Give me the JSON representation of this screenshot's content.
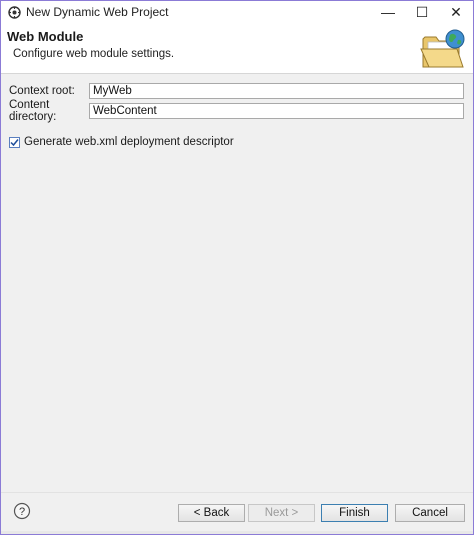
{
  "window": {
    "title": "New Dynamic Web Project",
    "minimize_glyph": "—",
    "maximize_glyph": "☐",
    "close_glyph": "✕"
  },
  "banner": {
    "title": "Web Module",
    "description": "Configure web module settings.",
    "icon": "folder-globe-icon"
  },
  "form": {
    "context_root_label": "Context root:",
    "context_root_value": "MyWeb",
    "content_dir_label": "Content directory:",
    "content_dir_value": "WebContent",
    "generate_checkbox_label": "Generate web.xml deployment descriptor",
    "generate_checked": true
  },
  "footer": {
    "help_icon": "help-icon",
    "back_label": "< Back",
    "next_label": "Next >",
    "finish_label": "Finish",
    "cancel_label": "Cancel"
  },
  "colors": {
    "window_border": "#8b7bd6",
    "dialog_bg": "#f0f0f0",
    "default_button_border": "#3c7fb1"
  }
}
